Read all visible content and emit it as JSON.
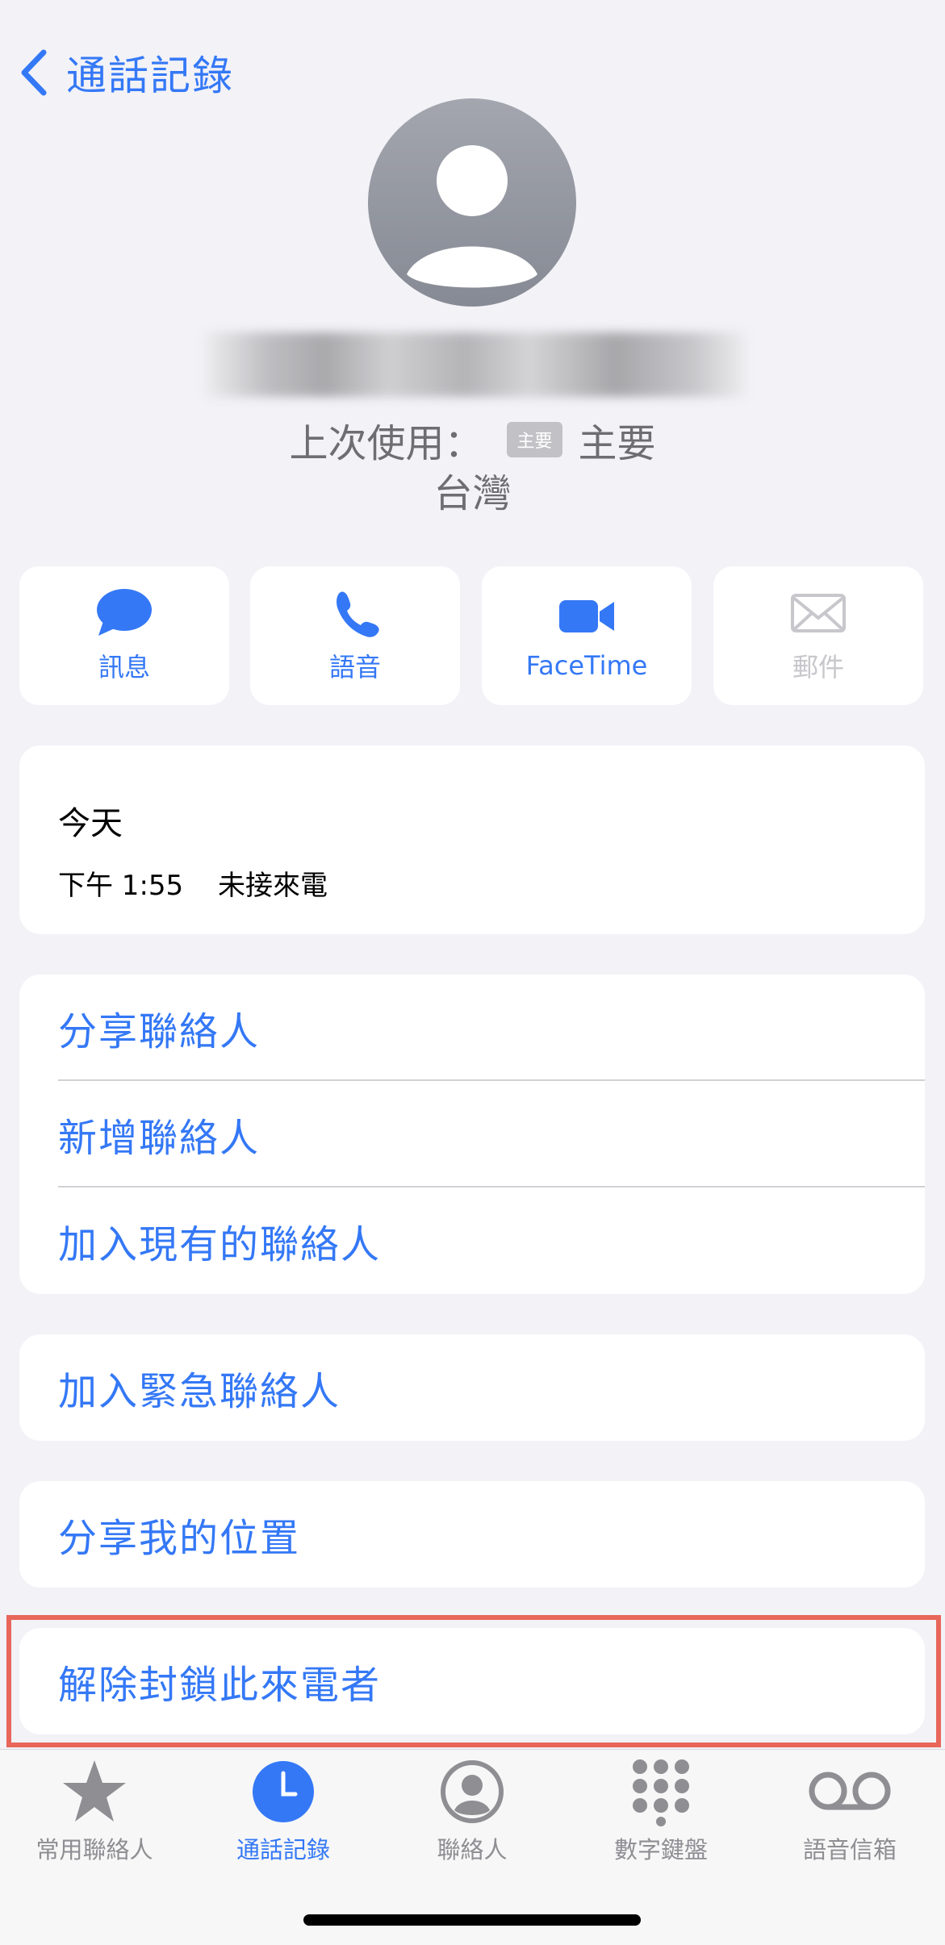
{
  "nav": {
    "back_label": "通話記錄"
  },
  "contact": {
    "last_used_label": "上次使用：",
    "tag": "主要",
    "last_used_value": "主要",
    "region": "台灣"
  },
  "actions": [
    {
      "label": "訊息",
      "icon": "message-bubble-icon"
    },
    {
      "label": "語音",
      "icon": "phone-icon"
    },
    {
      "label": "FaceTime",
      "icon": "video-camera-icon"
    },
    {
      "label": "郵件",
      "icon": "mail-envelope-icon",
      "disabled": true
    }
  ],
  "call_log": {
    "date": "今天",
    "time": "下午 1:55",
    "status": "未接來電"
  },
  "options": {
    "share_contact": "分享聯絡人",
    "new_contact": "新增聯絡人",
    "add_existing": "加入現有的聯絡人",
    "add_emergency": "加入緊急聯絡人",
    "share_location": "分享我的位置",
    "unblock": "解除封鎖此來電者"
  },
  "tabs": [
    {
      "label": "常用聯絡人",
      "icon": "star-icon"
    },
    {
      "label": "通話記錄",
      "icon": "clock-icon",
      "active": true
    },
    {
      "label": "聯絡人",
      "icon": "person-circle-icon"
    },
    {
      "label": "數字鍵盤",
      "icon": "keypad-icon"
    },
    {
      "label": "語音信箱",
      "icon": "voicemail-icon"
    }
  ],
  "colors": {
    "accent": "#3478f6",
    "highlight": "#e8665a"
  }
}
